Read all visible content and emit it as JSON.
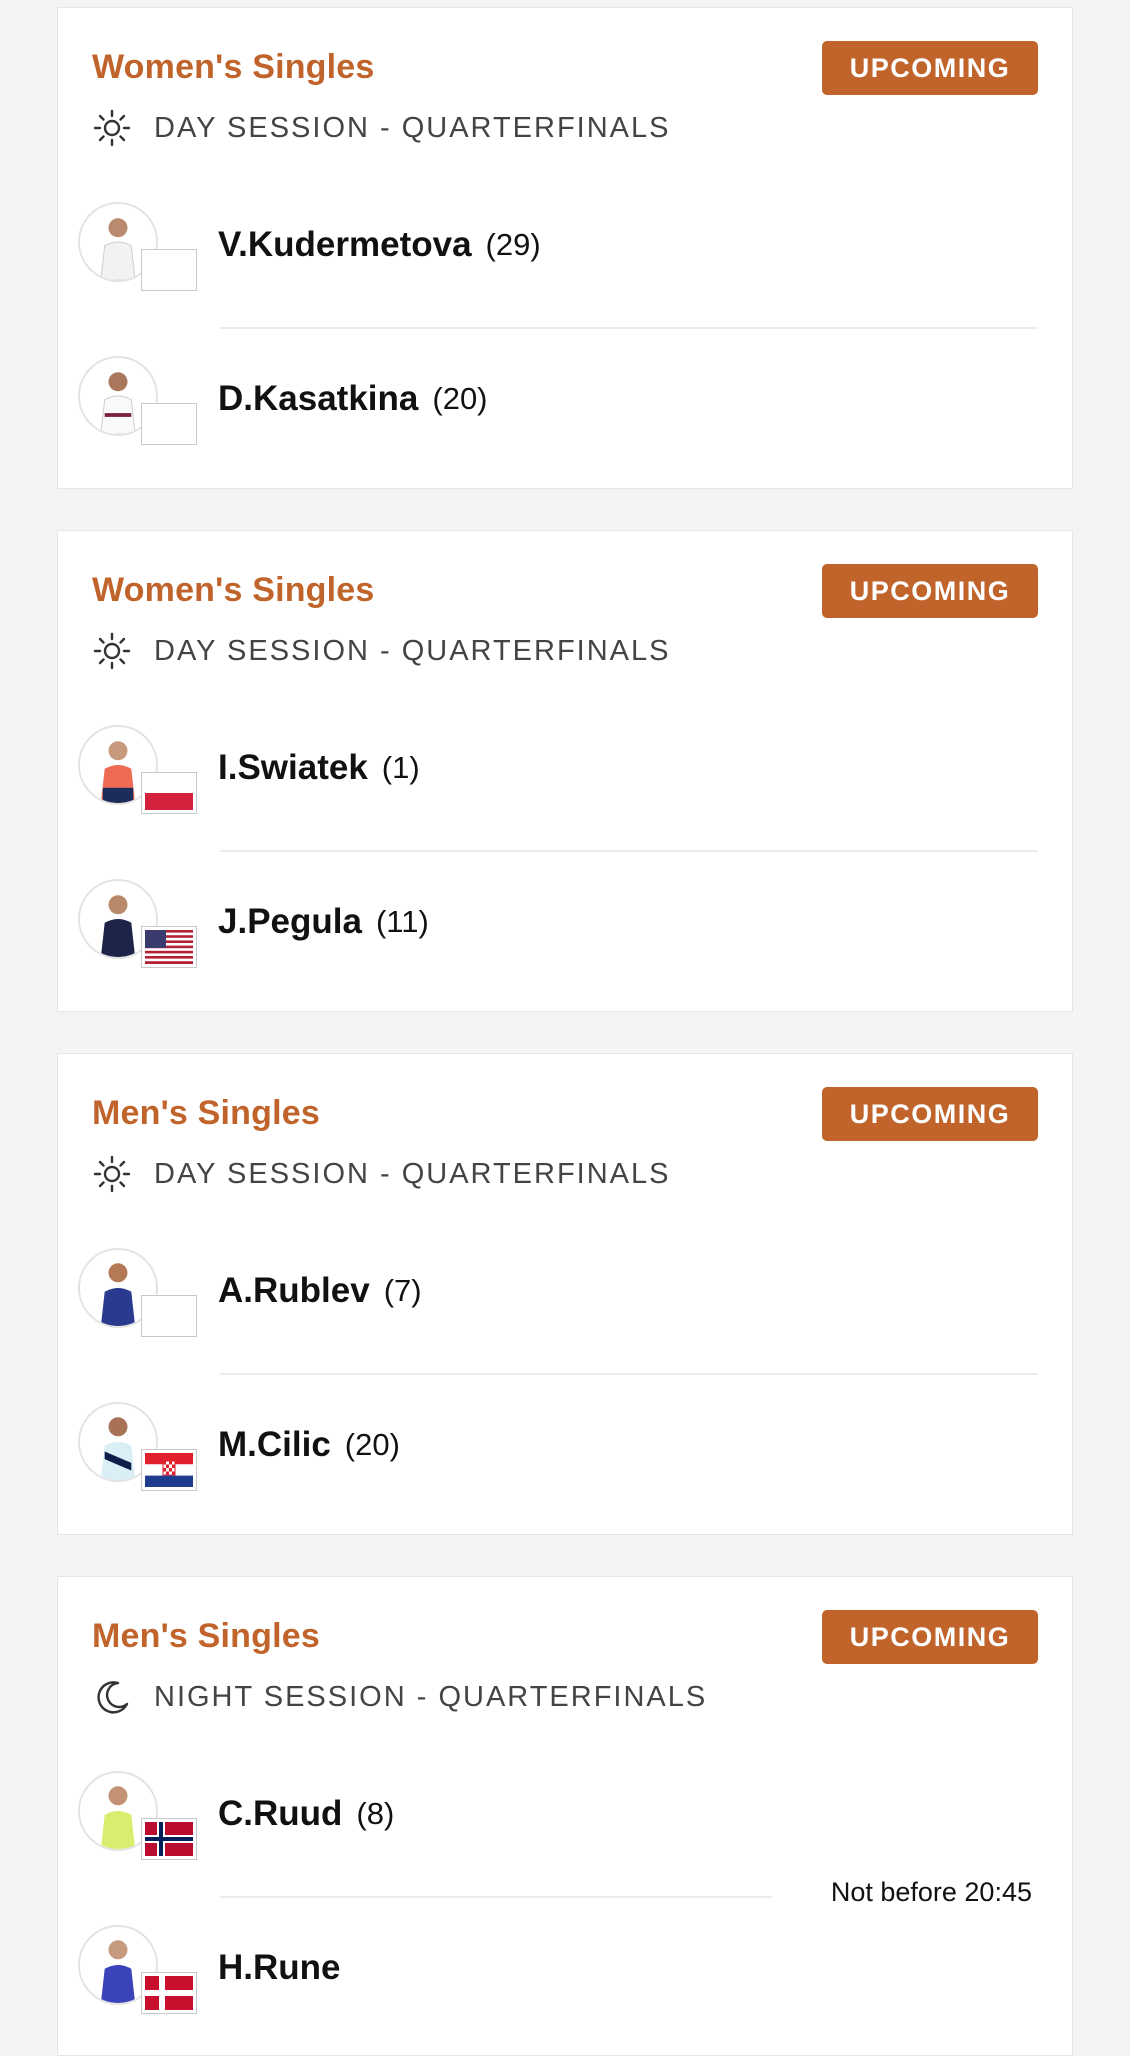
{
  "status_label": "UPCOMING",
  "accent_color": "#c0642b",
  "matches": [
    {
      "event": "Women's Singles",
      "session": "DAY SESSION - QUARTERFINALS",
      "session_icon": "sun-icon",
      "players": [
        {
          "name": "V.Kudermetova",
          "seed": "(29)",
          "flag": "blank"
        },
        {
          "name": "D.Kasatkina",
          "seed": "(20)",
          "flag": "blank"
        }
      ]
    },
    {
      "event": "Women's Singles",
      "session": "DAY SESSION - QUARTERFINALS",
      "session_icon": "sun-icon",
      "players": [
        {
          "name": "I.Swiatek",
          "seed": "(1)",
          "flag": "poland"
        },
        {
          "name": "J.Pegula",
          "seed": "(11)",
          "flag": "usa"
        }
      ]
    },
    {
      "event": "Men's Singles",
      "session": "DAY SESSION - QUARTERFINALS",
      "session_icon": "sun-icon",
      "players": [
        {
          "name": "A.Rublev",
          "seed": "(7)",
          "flag": "blank"
        },
        {
          "name": "M.Cilic",
          "seed": "(20)",
          "flag": "croatia"
        }
      ]
    },
    {
      "event": "Men's Singles",
      "session": "NIGHT SESSION - QUARTERFINALS",
      "session_icon": "moon-icon",
      "time_note": "Not before 20:45",
      "players": [
        {
          "name": "C.Ruud",
          "seed": "(8)",
          "flag": "norway"
        },
        {
          "name": "H.Rune",
          "seed": "",
          "flag": "denmark"
        }
      ]
    }
  ]
}
